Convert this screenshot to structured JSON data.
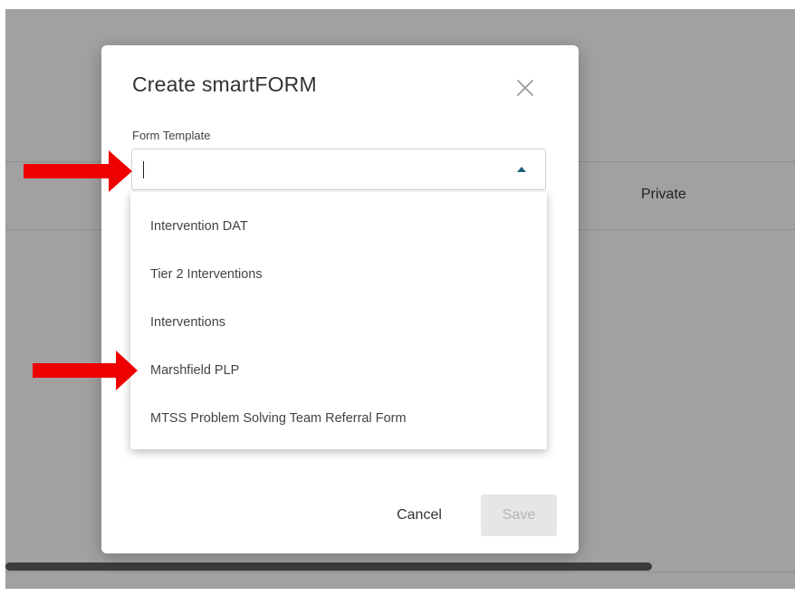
{
  "background": {
    "table_cell_text": "Private"
  },
  "dialog": {
    "title": "Create smartFORM",
    "field_label": "Form Template",
    "input_value": "",
    "options": [
      "Intervention DAT",
      "Tier 2 Interventions",
      "Interventions",
      "Marshfield PLP",
      "MTSS Problem Solving Team Referral Form"
    ],
    "cancel_label": "Cancel",
    "save_label": "Save",
    "save_enabled": false
  },
  "icons": {
    "close": "close-icon",
    "dropdown_arrow": "chevron-up-icon"
  },
  "colors": {
    "backdrop": "#a1a1a1",
    "accent": "#1d5f7a",
    "annotation": "#ee0000"
  }
}
